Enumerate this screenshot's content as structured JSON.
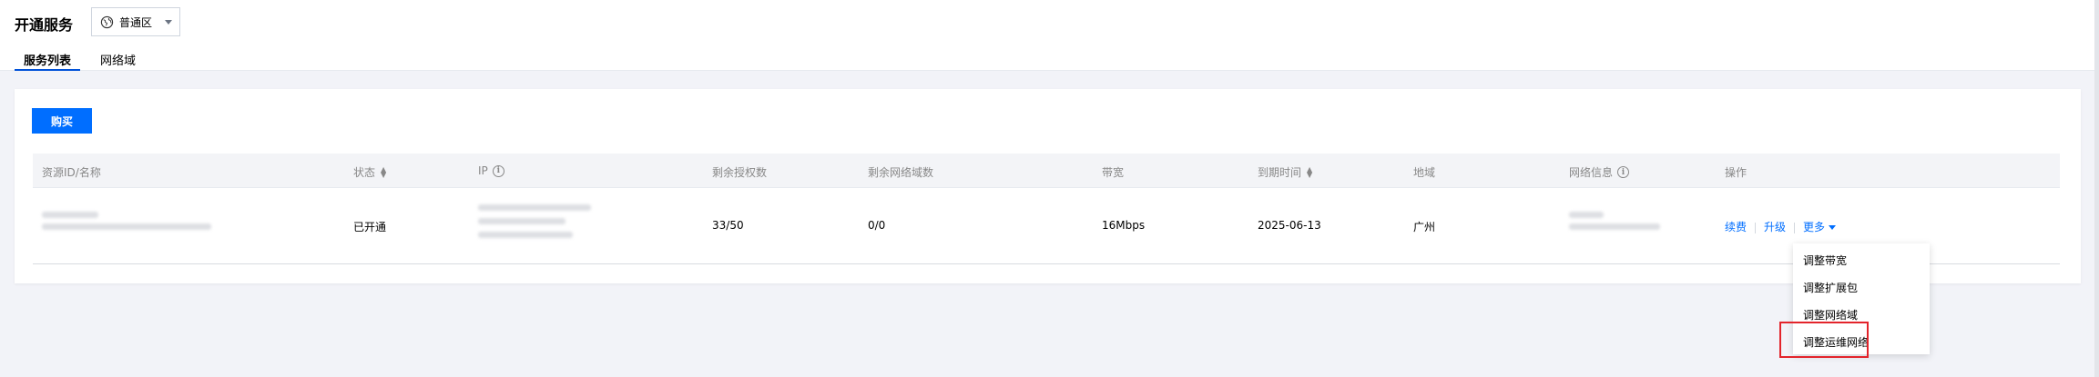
{
  "header": {
    "title": "开通服务",
    "region": {
      "icon": "globe-icon",
      "label": "普通区"
    }
  },
  "tabs": [
    {
      "label": "服务列表",
      "active": true
    },
    {
      "label": "网络域",
      "active": false
    }
  ],
  "toolbar": {
    "buy_label": "购买"
  },
  "table": {
    "columns": [
      {
        "label": "资源ID/名称"
      },
      {
        "label": "状态"
      },
      {
        "label": "IP"
      },
      {
        "label": "剩余授权数"
      },
      {
        "label": "剩余网络域数"
      },
      {
        "label": "带宽"
      },
      {
        "label": "到期时间"
      },
      {
        "label": "地域"
      },
      {
        "label": "网络信息"
      },
      {
        "label": "操作"
      }
    ],
    "rows": [
      {
        "status": "已开通",
        "licenses": "33/50",
        "domains": "0/0",
        "bandwidth": "16Mbps",
        "expire": "2025-06-13",
        "region": "广州",
        "actions": {
          "renew": "续费",
          "upgrade": "升级",
          "more": "更多"
        }
      }
    ]
  },
  "more_menu": {
    "items": [
      {
        "label": "调整带宽"
      },
      {
        "label": "调整扩展包"
      },
      {
        "label": "调整网络域"
      },
      {
        "label": "调整运维网络"
      }
    ]
  },
  "colors": {
    "primary": "#006eff",
    "tab_indicator": "#0052d9",
    "highlight": "#e3242b",
    "background": "#f2f3f8"
  }
}
